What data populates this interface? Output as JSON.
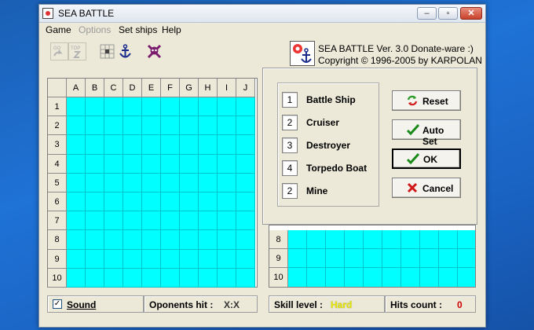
{
  "window": {
    "title": "SEA BATTLE",
    "minimize": "–",
    "maximize": "▫",
    "close": "✕"
  },
  "menu": [
    "Game",
    "Options",
    "Set ships",
    "Help"
  ],
  "toolbar": {
    "buttons": [
      "go-undo-icon",
      "top-redo-icon",
      "ship-grid-icon",
      "anchor-icon",
      "skull-icon"
    ]
  },
  "app_info": {
    "version_line": "SEA BATTLE Ver. 3.0  Donate-ware :)",
    "copyright_line": "Copyright © 1996-2005 by KARPOLAN"
  },
  "board": {
    "columns": [
      "A",
      "B",
      "C",
      "D",
      "E",
      "F",
      "G",
      "H",
      "I",
      "J"
    ],
    "rows": [
      "1",
      "2",
      "3",
      "4",
      "5",
      "6",
      "7",
      "8",
      "9",
      "10"
    ],
    "right_visible_rows": [
      "8",
      "9",
      "10"
    ]
  },
  "ships": [
    {
      "count": "1",
      "name": "Battle Ship"
    },
    {
      "count": "2",
      "name": "Cruiser"
    },
    {
      "count": "3",
      "name": "Destroyer"
    },
    {
      "count": "4",
      "name": "Torpedo Boat"
    },
    {
      "count": "2",
      "name": "Mine"
    }
  ],
  "actions": {
    "reset": "Reset",
    "auto_set": "Auto Set",
    "ok": "OK",
    "cancel": "Cancel"
  },
  "status": {
    "sound_label": "Sound",
    "sound_checked": true,
    "opponents_hit_label": "Oponents hit :",
    "opponents_hit_value": "X:X",
    "skill_label": "Skill level :",
    "skill_value": "Hard",
    "hits_label": "Hits count :",
    "hits_value": "0"
  },
  "colors": {
    "water": "#00ffff",
    "skill_value": "#e8e800",
    "hits_value": "#cc0000"
  }
}
